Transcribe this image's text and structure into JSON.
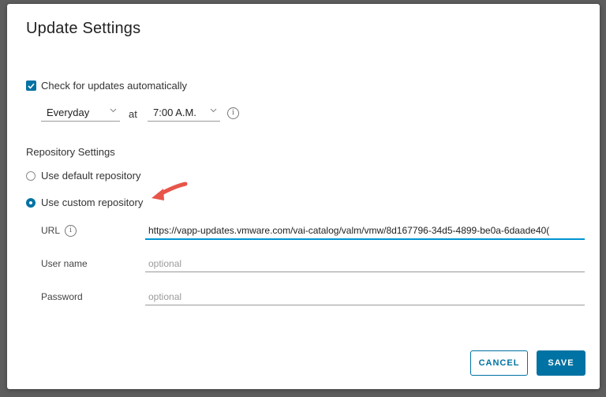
{
  "dialog": {
    "title": "Update Settings"
  },
  "updates": {
    "auto_check_label": "Check for updates automatically",
    "auto_check_checked": true,
    "frequency_value": "Everyday",
    "at_label": "at",
    "time_value": "7:00 A.M."
  },
  "repository": {
    "section_title": "Repository Settings",
    "default_label": "Use default repository",
    "custom_label": "Use custom repository",
    "selected": "custom"
  },
  "fields": {
    "url_label": "URL",
    "url_value": "https://vapp-updates.vmware.com/vai-catalog/valm/vmw/8d167796-34d5-4899-be0a-6daade40(",
    "username_label": "User name",
    "username_placeholder": "optional",
    "password_label": "Password",
    "password_placeholder": "optional"
  },
  "buttons": {
    "cancel_label": "CANCEL",
    "save_label": "SAVE"
  },
  "icons": {
    "info": "info-icon",
    "arrow": "red-pointer-arrow-icon",
    "check": "checkmark-icon",
    "chevron": "chevron-down-icon"
  },
  "colors": {
    "accent": "#0072a3",
    "annotation_arrow": "#e8554a"
  }
}
